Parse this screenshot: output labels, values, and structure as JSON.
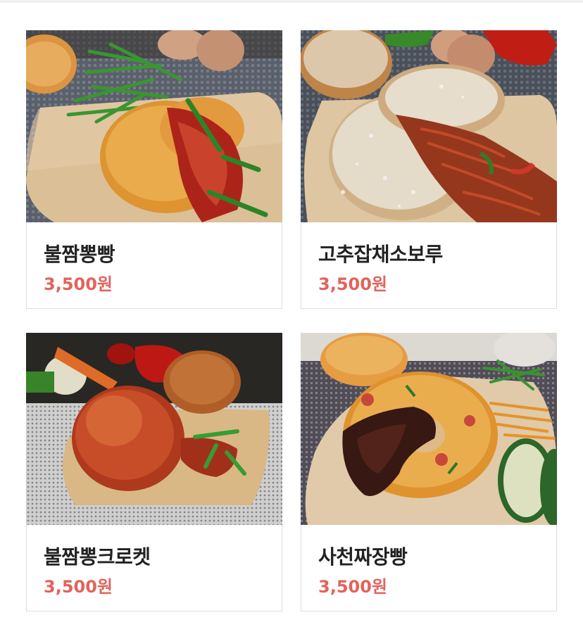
{
  "products": [
    {
      "name": "불짬뽕빵",
      "price": "3,500원",
      "image": "bul-jjambbong-bread-photo"
    },
    {
      "name": "고추잡채소보루",
      "price": "3,500원",
      "image": "gochu-japchae-soboro-photo"
    },
    {
      "name": "불짬뽕크로켓",
      "price": "3,500원",
      "image": "bul-jjambbong-croquette-photo"
    },
    {
      "name": "사천짜장빵",
      "price": "3,500원",
      "image": "sacheon-jjajang-bread-photo"
    }
  ],
  "colors": {
    "price": "#e2635b",
    "name": "#222222",
    "card_border": "#dedede"
  }
}
